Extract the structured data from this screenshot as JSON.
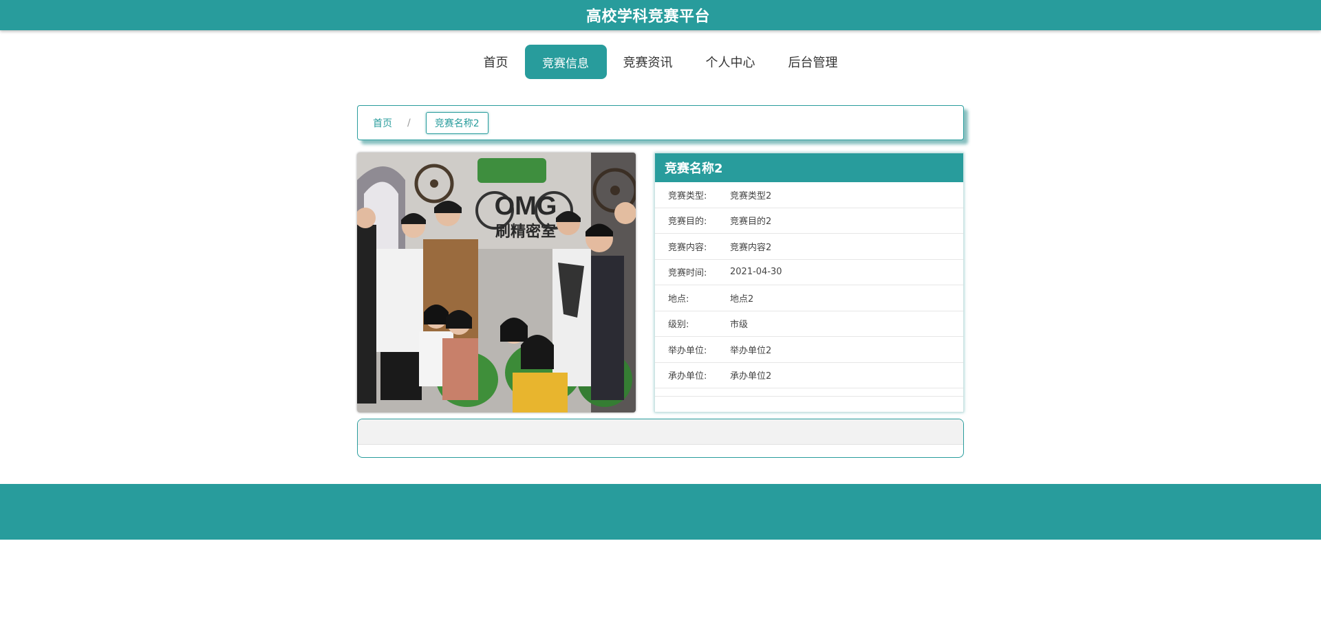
{
  "site": {
    "title": "高校学科竞赛平台"
  },
  "nav": {
    "items": [
      {
        "label": "首页"
      },
      {
        "label": "竞赛信息"
      },
      {
        "label": "竞赛资讯"
      },
      {
        "label": "个人中心"
      },
      {
        "label": "后台管理"
      }
    ],
    "active_index": 1
  },
  "breadcrumb": {
    "home": "首页",
    "separator": "/",
    "current": "竞赛名称2"
  },
  "photo": {
    "sign_text": "OMG",
    "sign_subtext": "刷精密室"
  },
  "competition": {
    "name": "竞赛名称2",
    "fields": [
      {
        "label": "竞赛类型:",
        "value": "竞赛类型2"
      },
      {
        "label": "竞赛目的:",
        "value": "竞赛目的2"
      },
      {
        "label": "竞赛内容:",
        "value": "竞赛内容2"
      },
      {
        "label": "竞赛时间:",
        "value": "2021-04-30"
      },
      {
        "label": "地点:",
        "value": "地点2"
      },
      {
        "label": "级别:",
        "value": "市级"
      },
      {
        "label": "举办单位:",
        "value": "举办单位2"
      },
      {
        "label": "承办单位:",
        "value": "承办单位2"
      }
    ]
  },
  "colors": {
    "primary": "#289c9c",
    "panel_header_bg": "#f2f2f2",
    "text": "#333333"
  }
}
